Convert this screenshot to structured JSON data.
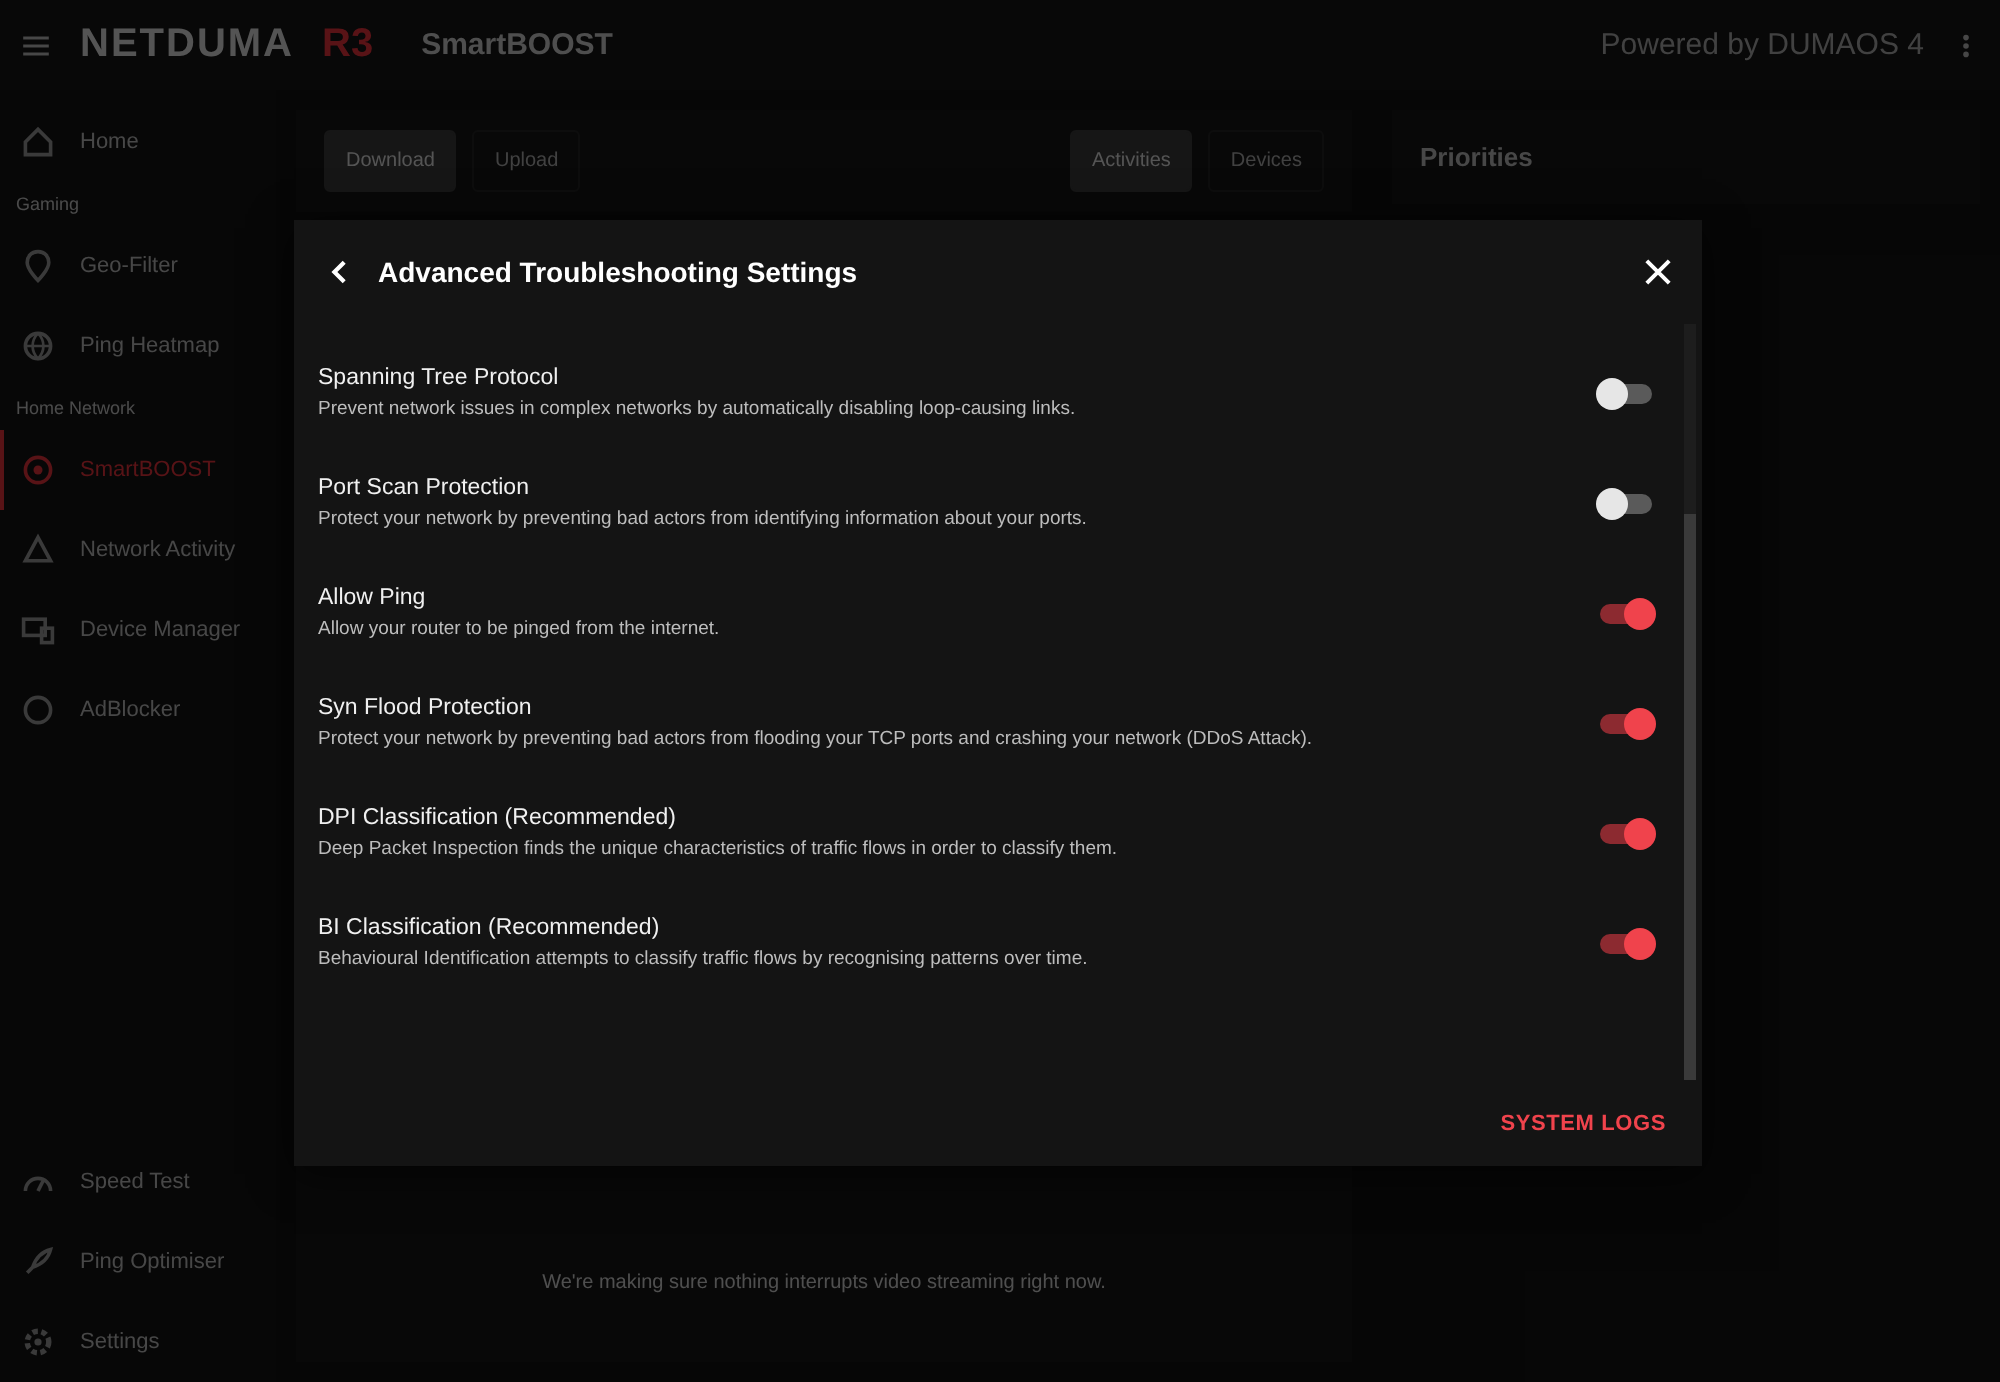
{
  "header": {
    "brand": "NETDUMA",
    "brand_model": "R3",
    "page_title": "SmartBOOST",
    "powered_by": "Powered by DUMAOS 4"
  },
  "sidebar": {
    "sections": [
      {
        "items": [
          {
            "label": "Home",
            "selected": false
          }
        ]
      },
      {
        "heading": "Gaming",
        "items": [
          {
            "label": "Geo-Filter",
            "selected": false
          },
          {
            "label": "Ping Heatmap",
            "selected": false
          }
        ]
      },
      {
        "heading": "Home Network",
        "items": [
          {
            "label": "SmartBOOST",
            "selected": true
          },
          {
            "label": "Network Activity",
            "selected": false
          },
          {
            "label": "Device Manager",
            "selected": false
          },
          {
            "label": "AdBlocker",
            "selected": false
          }
        ]
      }
    ],
    "bottom_items": [
      {
        "label": "Speed Test",
        "selected": false
      },
      {
        "label": "Ping Optimiser",
        "selected": false
      },
      {
        "label": "Settings",
        "selected": false
      }
    ]
  },
  "main": {
    "left_tabs": [
      {
        "label": "Download",
        "selected": true
      },
      {
        "label": "Upload",
        "selected": false
      }
    ],
    "right_tabs": [
      {
        "label": "Activities",
        "selected": true
      },
      {
        "label": "Devices",
        "selected": false
      }
    ],
    "empty_message": "We're making sure nothing interrupts video streaming right now."
  },
  "priorities": {
    "title": "Priorities"
  },
  "dialog": {
    "title": "Advanced Troubleshooting Settings",
    "settings": [
      {
        "title": "Spanning Tree Protocol",
        "description": "Prevent network issues in complex networks by automatically disabling loop-causing links.",
        "on": false
      },
      {
        "title": "Port Scan Protection",
        "description": "Protect your network by preventing bad actors from identifying information about your ports.",
        "on": false
      },
      {
        "title": "Allow Ping",
        "description": "Allow your router to be pinged from the internet.",
        "on": true
      },
      {
        "title": "Syn Flood Protection",
        "description": "Protect your network by preventing bad actors from flooding your TCP ports and crashing your network (DDoS Attack).",
        "on": true
      },
      {
        "title": "DPI Classification (Recommended)",
        "description": "Deep Packet Inspection finds the unique characteristics of traffic flows in order to classify them.",
        "on": true
      },
      {
        "title": "BI Classification (Recommended)",
        "description": "Behavioural Identification attempts to classify traffic flows by recognising patterns over time.",
        "on": true
      }
    ],
    "action": "SYSTEM LOGS"
  }
}
